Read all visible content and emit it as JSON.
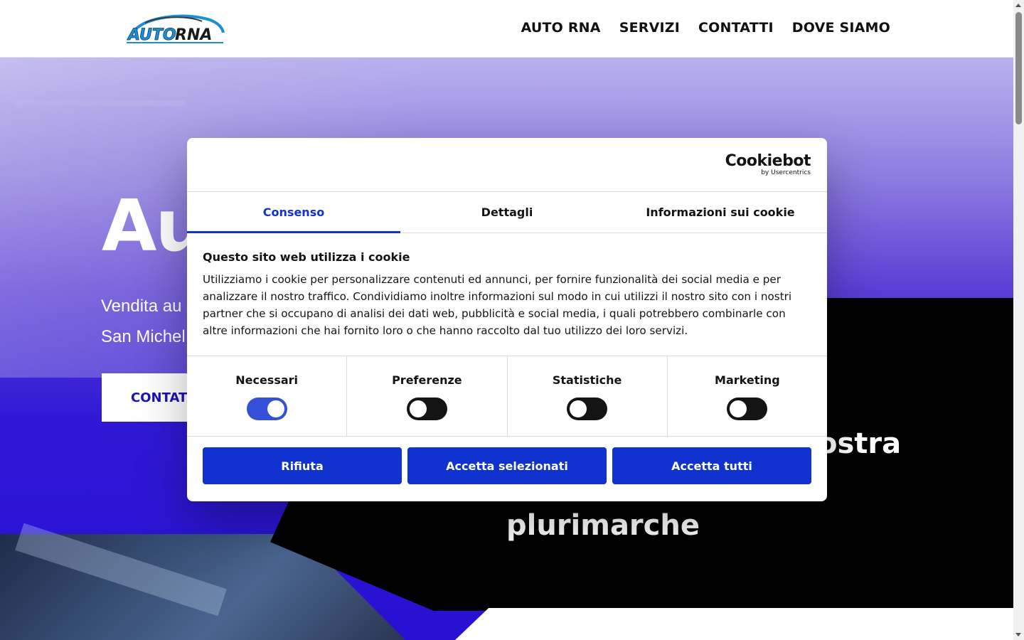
{
  "header": {
    "logo_alt": "AUTO RNA",
    "nav": [
      "AUTO RNA",
      "SERVIZI",
      "CONTATTI",
      "DOVE SIAMO"
    ]
  },
  "hero": {
    "title": "Au",
    "line1": "Vendita au",
    "line2": "San Michel",
    "button": "CONTATT",
    "heading1": "ostra",
    "heading2": "plurimarche"
  },
  "cookie_dialog": {
    "brand": {
      "name": "Cookiebot",
      "sub": "by Usercentrics"
    },
    "tabs": [
      "Consenso",
      "Dettagli",
      "Informazioni sui cookie"
    ],
    "active_tab": "Consenso",
    "title": "Questo sito web utilizza i cookie",
    "text": "Utilizziamo i cookie per personalizzare contenuti ed annunci, per fornire funzionalità dei social media e per analizzare il nostro traffico. Condividiamo inoltre informazioni sul modo in cui utilizzi il nostro sito con i nostri partner che si occupano di analisi dei dati web, pubblicità e social media, i quali potrebbero combinarle con altre informazioni che hai fornito loro o che hanno raccolto dal tuo utilizzo dei loro servizi.",
    "toggles": [
      {
        "label": "Necessari",
        "on": true
      },
      {
        "label": "Preferenze",
        "on": false
      },
      {
        "label": "Statistiche",
        "on": false
      },
      {
        "label": "Marketing",
        "on": false
      }
    ],
    "buttons": [
      "Rifiuta",
      "Accetta selezionati",
      "Accetta tutti"
    ]
  },
  "colors": {
    "accent": "#1032cf",
    "hero_blue": "#2810d2",
    "button_text": "#1d11b8"
  }
}
